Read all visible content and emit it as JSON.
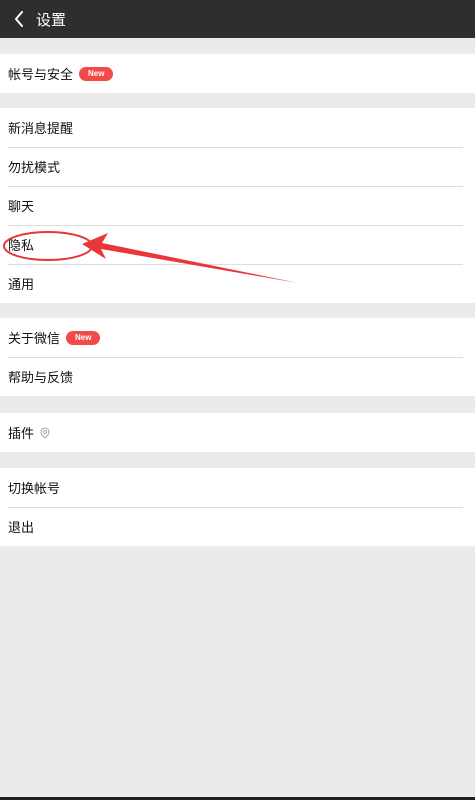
{
  "header": {
    "title": "设置"
  },
  "groups": [
    {
      "items": [
        {
          "label": "帐号与安全",
          "badge": "New"
        }
      ]
    },
    {
      "items": [
        {
          "label": "新消息提醒"
        },
        {
          "label": "勿扰模式"
        },
        {
          "label": "聊天"
        },
        {
          "label": "隐私"
        },
        {
          "label": "通用"
        }
      ]
    },
    {
      "items": [
        {
          "label": "关于微信",
          "badge": "New"
        },
        {
          "label": "帮助与反馈"
        }
      ]
    },
    {
      "items": [
        {
          "label": "插件",
          "icon": "plugin-icon"
        }
      ]
    },
    {
      "items": [
        {
          "label": "切换帐号"
        },
        {
          "label": "退出"
        }
      ]
    }
  ],
  "annotation_color": "#e8363a"
}
